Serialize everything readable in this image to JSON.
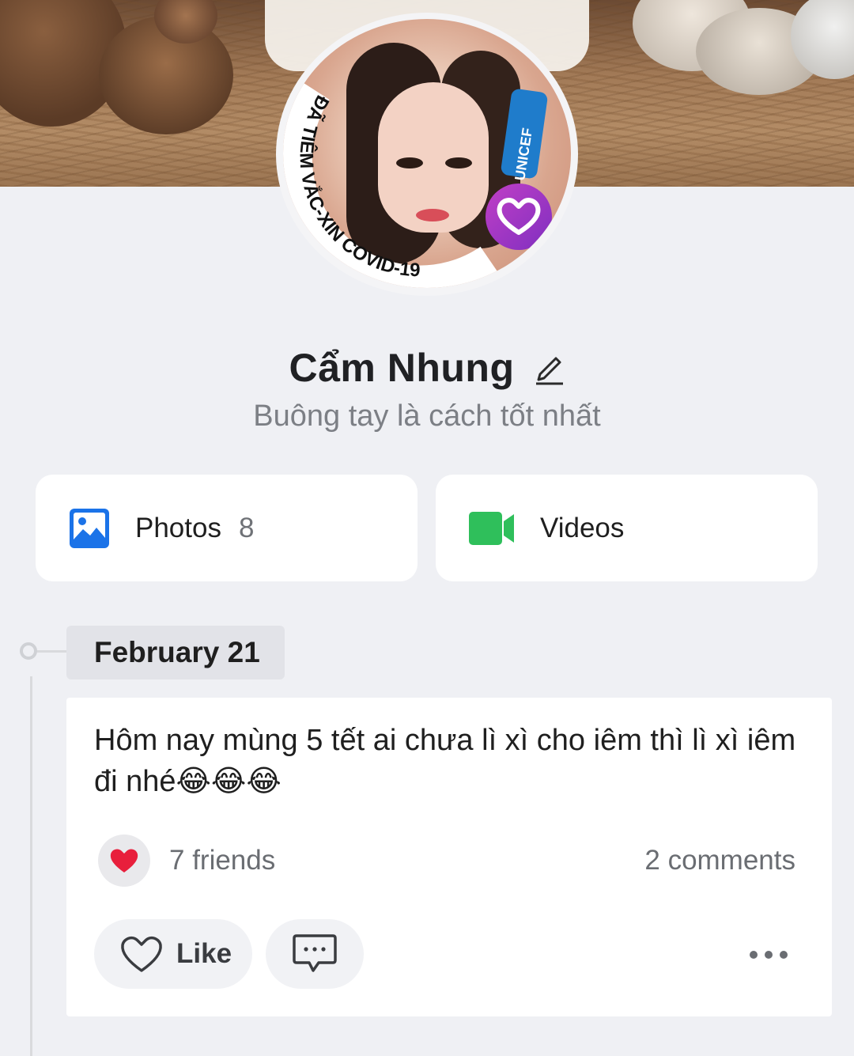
{
  "profile": {
    "name": "Cẩm Nhung",
    "bio": "Buông tay là cách tốt nhất",
    "avatar_frame_text": "ĐÃ TIÊM VẮC-XIN COVID-19",
    "avatar_badge_text": "UNICEF"
  },
  "media": {
    "photos_label": "Photos",
    "photos_count": "8",
    "videos_label": "Videos"
  },
  "timeline": {
    "date": "February 21"
  },
  "post": {
    "text": "Hôm nay mùng 5 tết ai chưa lì xì cho iêm thì lì xì iêm đi nhé😂😂😂",
    "reactions_label": "7 friends",
    "comments_label": "2 comments",
    "like_label": "Like"
  },
  "icons": {
    "edit": "pencil-icon",
    "photos": "image-icon",
    "videos": "video-camera-icon",
    "reaction": "heart-icon",
    "like": "heart-outline-icon",
    "comment": "comment-bubble-icon",
    "more": "more-dots-icon"
  },
  "colors": {
    "photos_icon": "#1b73e8",
    "videos_icon": "#2fbf5b",
    "heart": "#e81f3c",
    "background": "#eff0f4"
  }
}
